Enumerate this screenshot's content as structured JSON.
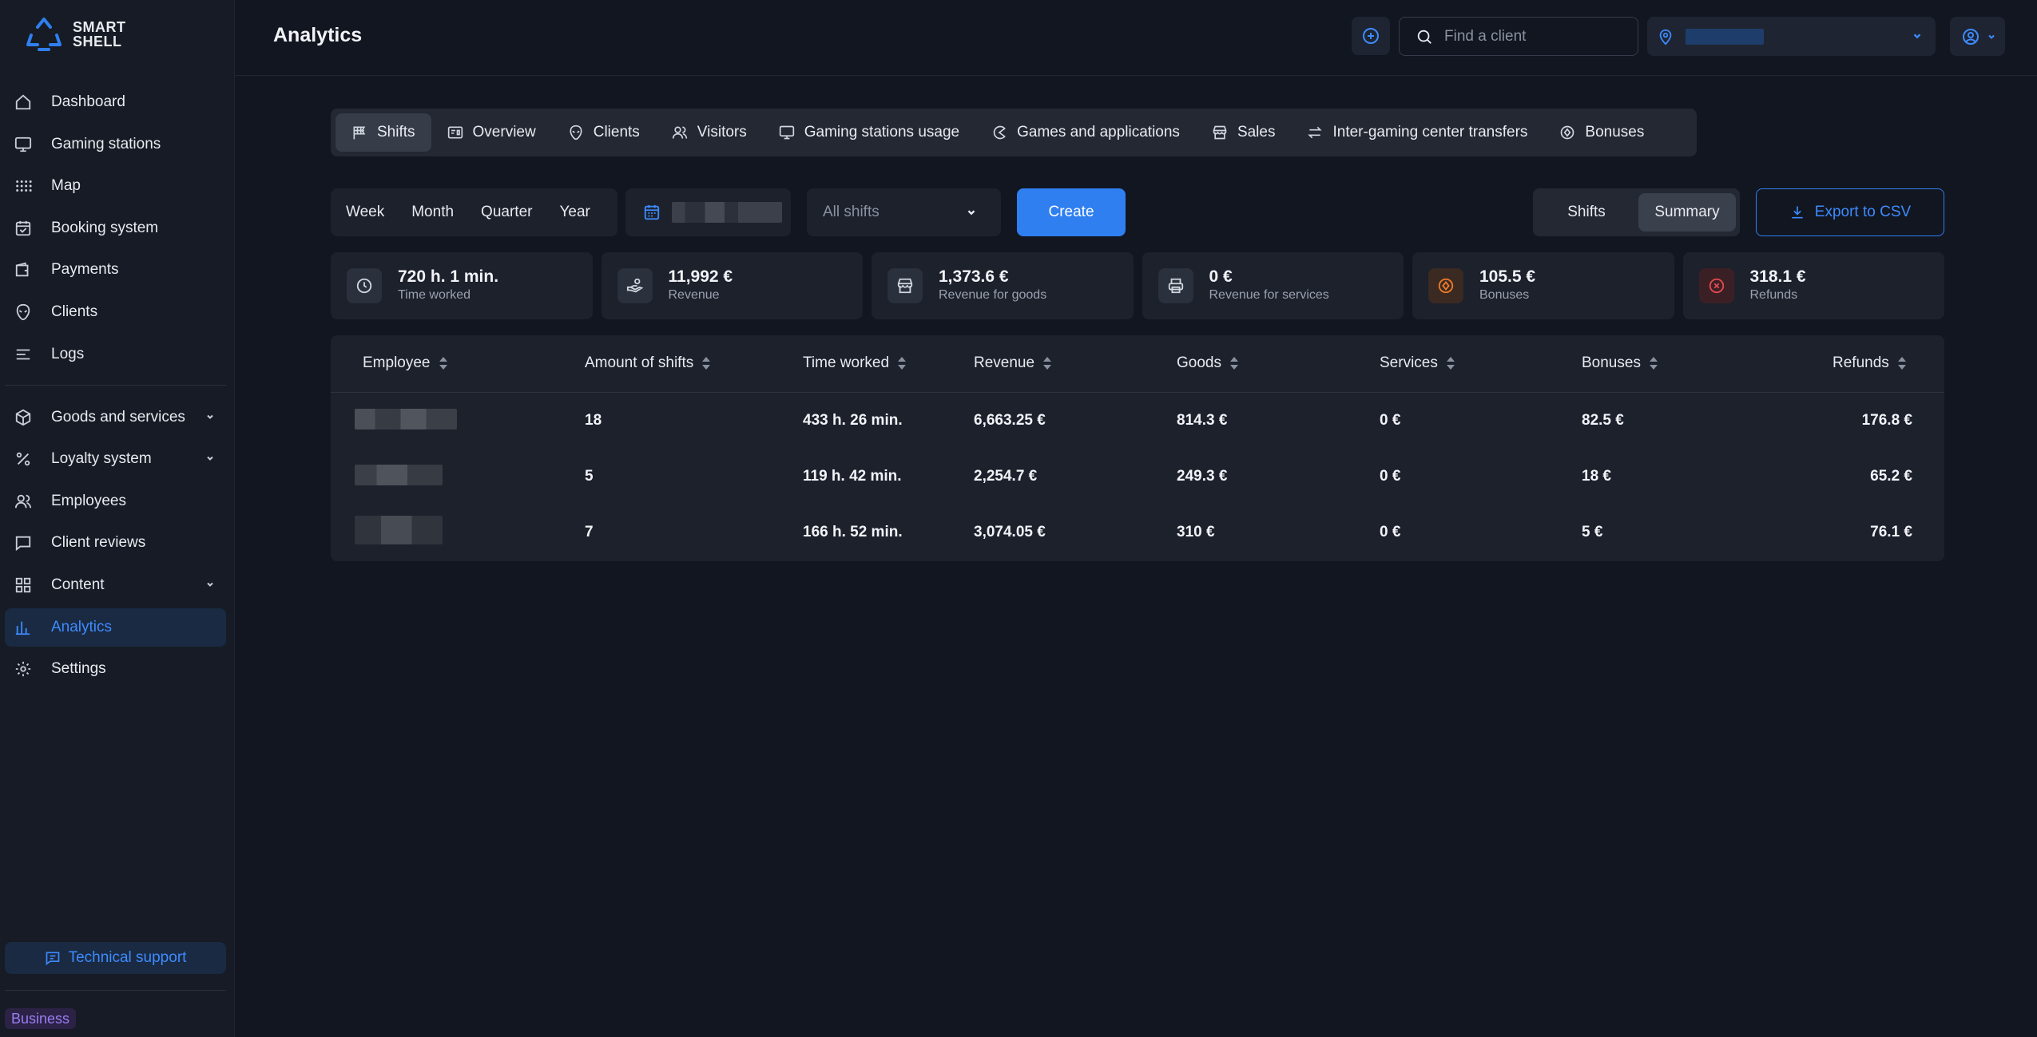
{
  "brand": {
    "line1": "SMART",
    "line2": "SHELL"
  },
  "sidebar": {
    "items": [
      {
        "label": "Dashboard",
        "icon": "home-icon"
      },
      {
        "label": "Gaming stations",
        "icon": "monitor-icon"
      },
      {
        "label": "Map",
        "icon": "grid-dots-icon"
      },
      {
        "label": "Booking system",
        "icon": "calendar-icon"
      },
      {
        "label": "Payments",
        "icon": "wallet-icon"
      },
      {
        "label": "Clients",
        "icon": "alien-icon"
      },
      {
        "label": "Logs",
        "icon": "list-icon"
      }
    ],
    "items2": [
      {
        "label": "Goods and services",
        "icon": "box-icon"
      },
      {
        "label": "Loyalty system",
        "icon": "percent-icon"
      },
      {
        "label": "Employees",
        "icon": "users-icon"
      },
      {
        "label": "Client reviews",
        "icon": "message-icon"
      },
      {
        "label": "Content",
        "icon": "grid-icon"
      },
      {
        "label": "Analytics",
        "icon": "chart-icon"
      },
      {
        "label": "Settings",
        "icon": "gear-icon"
      }
    ],
    "support": "Technical support",
    "plan_badge": "Business"
  },
  "header": {
    "title": "Analytics",
    "search_placeholder": "Find a client"
  },
  "tabs": [
    {
      "label": "Shifts",
      "icon": "flag-icon",
      "active": true
    },
    {
      "label": "Overview",
      "icon": "overview-icon"
    },
    {
      "label": "Clients",
      "icon": "alien-icon"
    },
    {
      "label": "Visitors",
      "icon": "users-icon"
    },
    {
      "label": "Gaming stations usage",
      "icon": "monitor-icon"
    },
    {
      "label": "Games and applications",
      "icon": "pacman-icon"
    },
    {
      "label": "Sales",
      "icon": "store-icon"
    },
    {
      "label": "Inter-gaming center transfers",
      "icon": "transfer-icon"
    },
    {
      "label": "Bonuses",
      "icon": "bonus-icon"
    }
  ],
  "filters": {
    "periods": [
      "Week",
      "Month",
      "Quarter",
      "Year"
    ],
    "shift_select": "All shifts",
    "create": "Create",
    "view_shifts": "Shifts",
    "view_summary": "Summary",
    "export": "Export to CSV"
  },
  "stats": [
    {
      "value": "720 h. 1 min.",
      "label": "Time worked",
      "icon": "clock-icon"
    },
    {
      "value": "11,992 €",
      "label": "Revenue",
      "icon": "money-hand-icon"
    },
    {
      "value": "1,373.6 €",
      "label": "Revenue for goods",
      "icon": "store-icon"
    },
    {
      "value": "0 €",
      "label": "Revenue for services",
      "icon": "printer-icon"
    },
    {
      "value": "105.5 €",
      "label": "Bonuses",
      "icon": "bonus-icon"
    },
    {
      "value": "318.1 €",
      "label": "Refunds",
      "icon": "cancel-icon"
    }
  ],
  "table": {
    "columns": [
      "Employee",
      "Amount of shifts",
      "Time worked",
      "Revenue",
      "Goods",
      "Services",
      "Bonuses",
      "Refunds"
    ],
    "rows": [
      [
        "18",
        "433 h. 26 min.",
        "6,663.25 €",
        "814.3 €",
        "0 €",
        "82.5 €",
        "176.8 €"
      ],
      [
        "5",
        "119 h. 42 min.",
        "2,254.7 €",
        "249.3 €",
        "0 €",
        "18 €",
        "65.2 €"
      ],
      [
        "7",
        "166 h. 52 min.",
        "3,074.05 €",
        "310 €",
        "0 €",
        "5 €",
        "76.1 €"
      ]
    ]
  },
  "colors": {
    "accent": "#2f7ff0",
    "bg": "#121620",
    "panel": "#1c212c",
    "bonus": "#f07a2a",
    "refund": "#e5484d"
  }
}
